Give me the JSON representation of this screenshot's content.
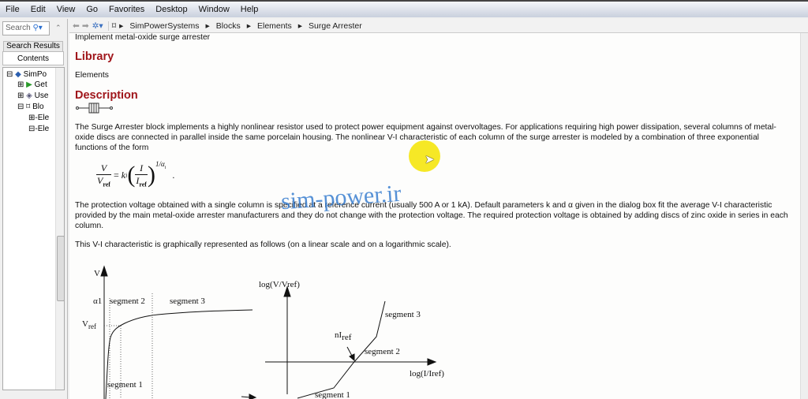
{
  "menu": [
    "File",
    "Edit",
    "View",
    "Go",
    "Favorites",
    "Desktop",
    "Window",
    "Help"
  ],
  "left": {
    "search_placeholder": "Search",
    "tab_search_results": "Search Results",
    "tab_contents": "Contents",
    "tree": [
      {
        "label": "SimPo"
      },
      {
        "label": "Get"
      },
      {
        "label": "Use"
      },
      {
        "label": "Blo"
      },
      {
        "label": "Ele"
      },
      {
        "label": "Ele"
      }
    ]
  },
  "breadcrumb": [
    "SimPowerSystems",
    "Blocks",
    "Elements",
    "Surge Arrester"
  ],
  "doc": {
    "subtitle": "Implement metal-oxide surge arrester",
    "library_heading": "Library",
    "library": "Elements",
    "description_heading": "Description",
    "para1": "The Surge Arrester block implements a highly nonlinear resistor used to protect power equipment against overvoltages. For applications requiring high power dissipation, several columns of metal-oxide discs are connected in parallel inside the same porcelain housing. The nonlinear V-I characteristic of each column of the surge arrester is modeled by a combination of three exponential functions of the form",
    "equation": {
      "lhs_num": "V",
      "lhs_den": "V",
      "lhs_den_sub": "ref",
      "k": "k",
      "k_sub": "i",
      "rhs_num": "I",
      "rhs_den": "I",
      "rhs_den_sub": "ref",
      "exponent": "1/α",
      "exp_sub": "i"
    },
    "para2": "The protection voltage obtained with a single column is specified at a reference current (usually 500 A or 1 kA). Default parameters k and α given in the dialog box fit the average V-I characteristic provided by the main metal-oxide arrester manufacturers and they do not change with the protection voltage. The required protection voltage is obtained by adding discs of zinc oxide in series in each column.",
    "para3": "This V-I characteristic is graphically represented as follows (on a linear scale and on a logarithmic scale)."
  },
  "figure": {
    "linear": {
      "y_label": "V",
      "alpha": "α1",
      "seg1": "segment  1",
      "seg2": "segment  2",
      "seg3": "segment  3",
      "vref": "V",
      "vref_sub": "ref"
    },
    "log": {
      "y_label": "log(V/Vref)",
      "x_label": "log(I/Iref)",
      "niref": "nI",
      "niref_sub": "ref",
      "seg1": "segment  1",
      "seg2": "segment  2",
      "seg3": "segment  3"
    }
  },
  "watermark": "sim-power.ir",
  "colors": {
    "heading": "#a0161b",
    "watermark": "#3a7fd0",
    "cursor_highlight": "#f5e400"
  }
}
